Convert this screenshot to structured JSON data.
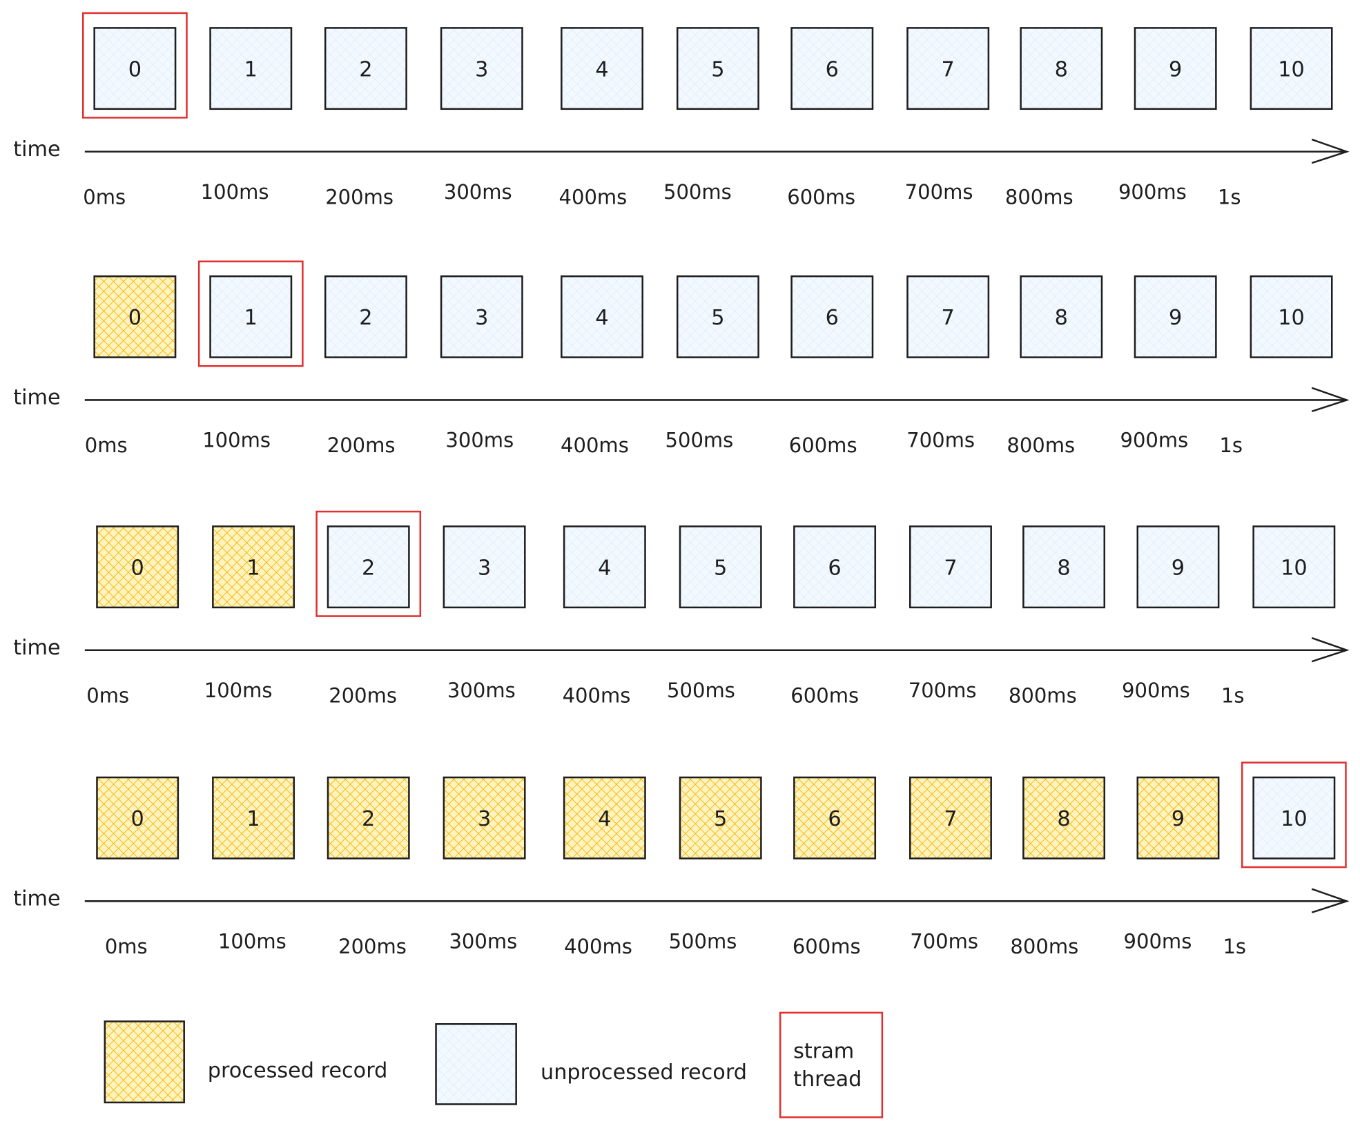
{
  "time_label": "time",
  "ticks": [
    "0ms",
    "100ms",
    "200ms",
    "300ms",
    "400ms",
    "500ms",
    "600ms",
    "700ms",
    "800ms",
    "900ms",
    "1s"
  ],
  "records": [
    "0",
    "1",
    "2",
    "3",
    "4",
    "5",
    "6",
    "7",
    "8",
    "9",
    "10"
  ],
  "rows": [
    {
      "processed_count": 0,
      "thread_at": 0
    },
    {
      "processed_count": 1,
      "thread_at": 1
    },
    {
      "processed_count": 2,
      "thread_at": 2
    },
    {
      "processed_count": 10,
      "thread_at": 10
    }
  ],
  "legend": {
    "processed": "processed record",
    "unprocessed": "unprocessed record",
    "thread_line1": "stram",
    "thread_line2": "thread"
  },
  "colors": {
    "processed_fill": "#fff3bf",
    "processed_hatch": "#f5b400",
    "unprocessed_fill": "#f3f9ff",
    "unprocessed_hatch": "#d0e8fb",
    "thread_border": "#e03131",
    "stroke": "#1e1e1e"
  }
}
